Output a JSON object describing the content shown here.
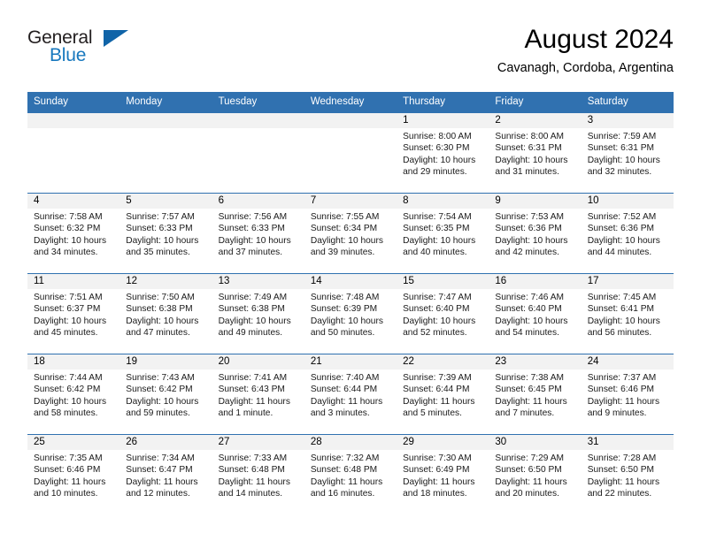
{
  "brand": {
    "name_part1": "General",
    "name_part2": "Blue",
    "logo_icon": "triangle-logo-icon"
  },
  "header": {
    "title": "August 2024",
    "location": "Cavanagh, Cordoba, Argentina"
  },
  "colors": {
    "header_blue": "#3071b0",
    "brand_blue": "#1878be",
    "date_band_gray": "#f2f2f2"
  },
  "weekday_headers": [
    "Sunday",
    "Monday",
    "Tuesday",
    "Wednesday",
    "Thursday",
    "Friday",
    "Saturday"
  ],
  "weeks": [
    [
      {
        "date": "",
        "lines": []
      },
      {
        "date": "",
        "lines": []
      },
      {
        "date": "",
        "lines": []
      },
      {
        "date": "",
        "lines": []
      },
      {
        "date": "1",
        "lines": [
          "Sunrise: 8:00 AM",
          "Sunset: 6:30 PM",
          "Daylight: 10 hours",
          "and 29 minutes."
        ]
      },
      {
        "date": "2",
        "lines": [
          "Sunrise: 8:00 AM",
          "Sunset: 6:31 PM",
          "Daylight: 10 hours",
          "and 31 minutes."
        ]
      },
      {
        "date": "3",
        "lines": [
          "Sunrise: 7:59 AM",
          "Sunset: 6:31 PM",
          "Daylight: 10 hours",
          "and 32 minutes."
        ]
      }
    ],
    [
      {
        "date": "4",
        "lines": [
          "Sunrise: 7:58 AM",
          "Sunset: 6:32 PM",
          "Daylight: 10 hours",
          "and 34 minutes."
        ]
      },
      {
        "date": "5",
        "lines": [
          "Sunrise: 7:57 AM",
          "Sunset: 6:33 PM",
          "Daylight: 10 hours",
          "and 35 minutes."
        ]
      },
      {
        "date": "6",
        "lines": [
          "Sunrise: 7:56 AM",
          "Sunset: 6:33 PM",
          "Daylight: 10 hours",
          "and 37 minutes."
        ]
      },
      {
        "date": "7",
        "lines": [
          "Sunrise: 7:55 AM",
          "Sunset: 6:34 PM",
          "Daylight: 10 hours",
          "and 39 minutes."
        ]
      },
      {
        "date": "8",
        "lines": [
          "Sunrise: 7:54 AM",
          "Sunset: 6:35 PM",
          "Daylight: 10 hours",
          "and 40 minutes."
        ]
      },
      {
        "date": "9",
        "lines": [
          "Sunrise: 7:53 AM",
          "Sunset: 6:36 PM",
          "Daylight: 10 hours",
          "and 42 minutes."
        ]
      },
      {
        "date": "10",
        "lines": [
          "Sunrise: 7:52 AM",
          "Sunset: 6:36 PM",
          "Daylight: 10 hours",
          "and 44 minutes."
        ]
      }
    ],
    [
      {
        "date": "11",
        "lines": [
          "Sunrise: 7:51 AM",
          "Sunset: 6:37 PM",
          "Daylight: 10 hours",
          "and 45 minutes."
        ]
      },
      {
        "date": "12",
        "lines": [
          "Sunrise: 7:50 AM",
          "Sunset: 6:38 PM",
          "Daylight: 10 hours",
          "and 47 minutes."
        ]
      },
      {
        "date": "13",
        "lines": [
          "Sunrise: 7:49 AM",
          "Sunset: 6:38 PM",
          "Daylight: 10 hours",
          "and 49 minutes."
        ]
      },
      {
        "date": "14",
        "lines": [
          "Sunrise: 7:48 AM",
          "Sunset: 6:39 PM",
          "Daylight: 10 hours",
          "and 50 minutes."
        ]
      },
      {
        "date": "15",
        "lines": [
          "Sunrise: 7:47 AM",
          "Sunset: 6:40 PM",
          "Daylight: 10 hours",
          "and 52 minutes."
        ]
      },
      {
        "date": "16",
        "lines": [
          "Sunrise: 7:46 AM",
          "Sunset: 6:40 PM",
          "Daylight: 10 hours",
          "and 54 minutes."
        ]
      },
      {
        "date": "17",
        "lines": [
          "Sunrise: 7:45 AM",
          "Sunset: 6:41 PM",
          "Daylight: 10 hours",
          "and 56 minutes."
        ]
      }
    ],
    [
      {
        "date": "18",
        "lines": [
          "Sunrise: 7:44 AM",
          "Sunset: 6:42 PM",
          "Daylight: 10 hours",
          "and 58 minutes."
        ]
      },
      {
        "date": "19",
        "lines": [
          "Sunrise: 7:43 AM",
          "Sunset: 6:42 PM",
          "Daylight: 10 hours",
          "and 59 minutes."
        ]
      },
      {
        "date": "20",
        "lines": [
          "Sunrise: 7:41 AM",
          "Sunset: 6:43 PM",
          "Daylight: 11 hours",
          "and 1 minute."
        ]
      },
      {
        "date": "21",
        "lines": [
          "Sunrise: 7:40 AM",
          "Sunset: 6:44 PM",
          "Daylight: 11 hours",
          "and 3 minutes."
        ]
      },
      {
        "date": "22",
        "lines": [
          "Sunrise: 7:39 AM",
          "Sunset: 6:44 PM",
          "Daylight: 11 hours",
          "and 5 minutes."
        ]
      },
      {
        "date": "23",
        "lines": [
          "Sunrise: 7:38 AM",
          "Sunset: 6:45 PM",
          "Daylight: 11 hours",
          "and 7 minutes."
        ]
      },
      {
        "date": "24",
        "lines": [
          "Sunrise: 7:37 AM",
          "Sunset: 6:46 PM",
          "Daylight: 11 hours",
          "and 9 minutes."
        ]
      }
    ],
    [
      {
        "date": "25",
        "lines": [
          "Sunrise: 7:35 AM",
          "Sunset: 6:46 PM",
          "Daylight: 11 hours",
          "and 10 minutes."
        ]
      },
      {
        "date": "26",
        "lines": [
          "Sunrise: 7:34 AM",
          "Sunset: 6:47 PM",
          "Daylight: 11 hours",
          "and 12 minutes."
        ]
      },
      {
        "date": "27",
        "lines": [
          "Sunrise: 7:33 AM",
          "Sunset: 6:48 PM",
          "Daylight: 11 hours",
          "and 14 minutes."
        ]
      },
      {
        "date": "28",
        "lines": [
          "Sunrise: 7:32 AM",
          "Sunset: 6:48 PM",
          "Daylight: 11 hours",
          "and 16 minutes."
        ]
      },
      {
        "date": "29",
        "lines": [
          "Sunrise: 7:30 AM",
          "Sunset: 6:49 PM",
          "Daylight: 11 hours",
          "and 18 minutes."
        ]
      },
      {
        "date": "30",
        "lines": [
          "Sunrise: 7:29 AM",
          "Sunset: 6:50 PM",
          "Daylight: 11 hours",
          "and 20 minutes."
        ]
      },
      {
        "date": "31",
        "lines": [
          "Sunrise: 7:28 AM",
          "Sunset: 6:50 PM",
          "Daylight: 11 hours",
          "and 22 minutes."
        ]
      }
    ]
  ]
}
